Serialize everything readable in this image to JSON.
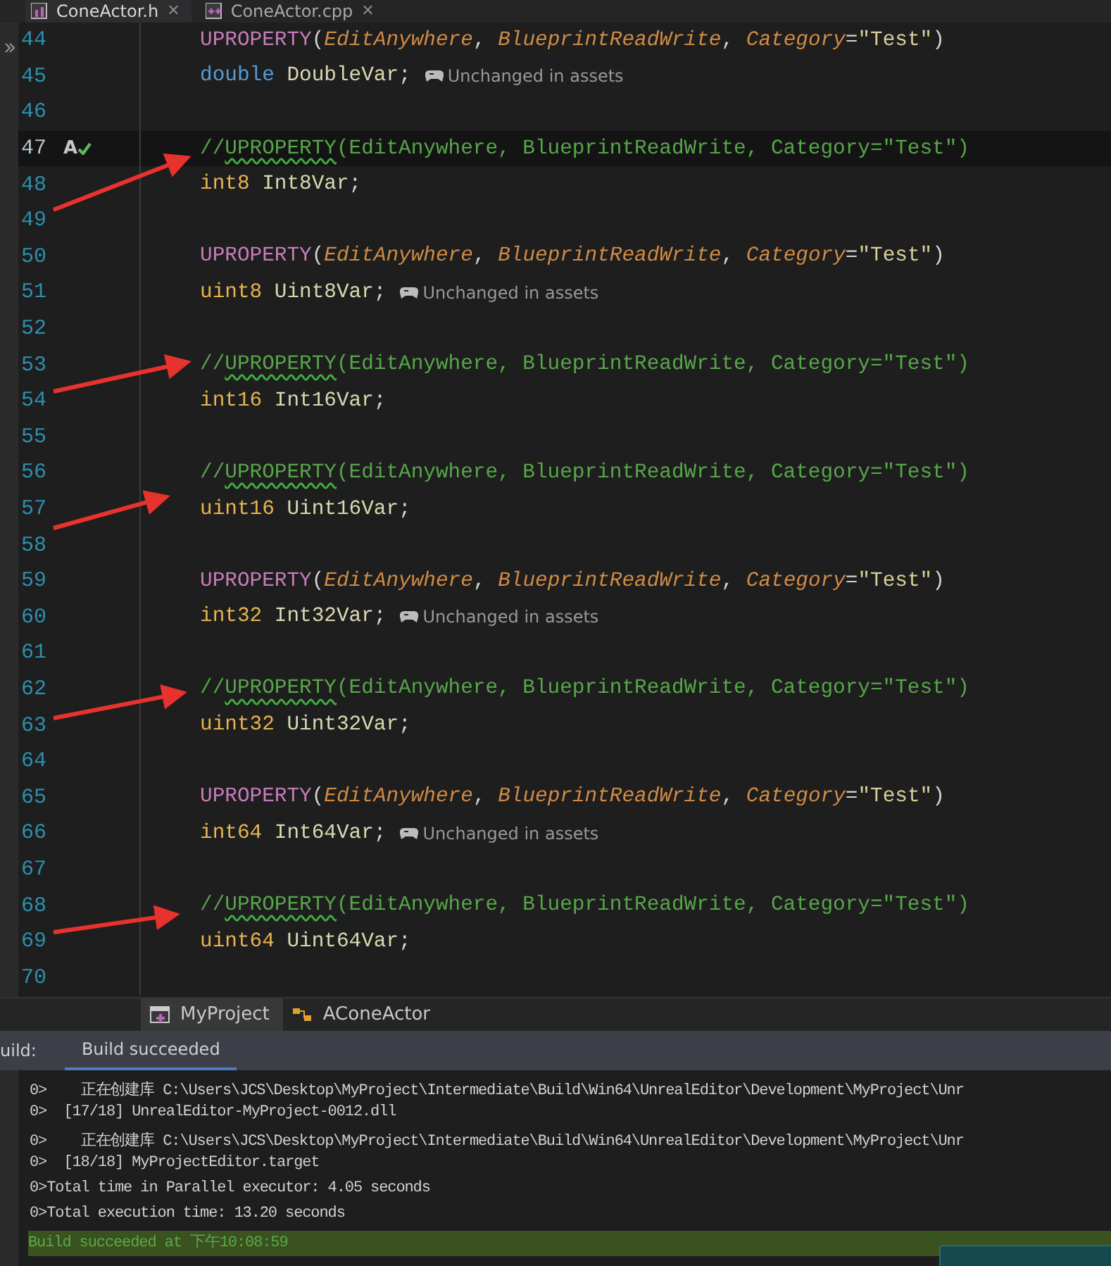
{
  "editor_tabs": [
    {
      "label": "ConeActor.h",
      "kind": "header",
      "close": "✕",
      "selected": true
    },
    {
      "label": "ConeActor.cpp",
      "kind": "source",
      "close": "✕",
      "selected": false
    }
  ],
  "code_lines": [
    {
      "number": "44",
      "tokens": [
        {
          "text": "UPROPERTY",
          "kind": "macro"
        },
        {
          "text": "(",
          "kind": "punct"
        },
        {
          "text": "EditAnywhere",
          "kind": "param"
        },
        {
          "text": ", ",
          "kind": "punct"
        },
        {
          "text": "BlueprintReadWrite",
          "kind": "param"
        },
        {
          "text": ", ",
          "kind": "punct"
        },
        {
          "text": "Category",
          "kind": "param"
        },
        {
          "text": "=",
          "kind": "punct"
        },
        {
          "text": "\"Test\"",
          "kind": "string"
        },
        {
          "text": ")",
          "kind": "punct"
        }
      ]
    },
    {
      "number": "45",
      "tokens": [
        {
          "text": "double",
          "kind": "keyword"
        },
        {
          "text": "DoubleVar",
          "kind": "ident"
        },
        {
          "text": ";",
          "kind": "punct"
        }
      ],
      "hint": "Unchanged in assets"
    },
    {
      "number": "46"
    },
    {
      "number": "47",
      "current": true,
      "gutter_mark": "A",
      "tokens": [
        {
          "text": "//",
          "kind": "comment"
        },
        {
          "text": "UPROPERTY",
          "kind": "squiggle"
        },
        {
          "text": "(EditAnywhere, BlueprintReadWrite, Category=\"Test\")",
          "kind": "comment"
        }
      ]
    },
    {
      "number": "48",
      "tokens": [
        {
          "text": "int8",
          "kind": "type"
        },
        {
          "text": "Int8Var",
          "kind": "ident"
        },
        {
          "text": ";",
          "kind": "punct"
        }
      ]
    },
    {
      "number": "49"
    },
    {
      "number": "50",
      "tokens": [
        {
          "text": "UPROPERTY",
          "kind": "macro"
        },
        {
          "text": "(",
          "kind": "punct"
        },
        {
          "text": "EditAnywhere",
          "kind": "param"
        },
        {
          "text": ", ",
          "kind": "punct"
        },
        {
          "text": "BlueprintReadWrite",
          "kind": "param"
        },
        {
          "text": ", ",
          "kind": "punct"
        },
        {
          "text": "Category",
          "kind": "param"
        },
        {
          "text": "=",
          "kind": "punct"
        },
        {
          "text": "\"Test\"",
          "kind": "string"
        },
        {
          "text": ")",
          "kind": "punct"
        }
      ]
    },
    {
      "number": "51",
      "tokens": [
        {
          "text": "uint8",
          "kind": "type"
        },
        {
          "text": "Uint8Var",
          "kind": "ident"
        },
        {
          "text": ";",
          "kind": "punct"
        }
      ],
      "hint": "Unchanged in assets"
    },
    {
      "number": "52"
    },
    {
      "number": "53",
      "tokens": [
        {
          "text": "//",
          "kind": "comment"
        },
        {
          "text": "UPROPERTY",
          "kind": "squiggle"
        },
        {
          "text": "(EditAnywhere, BlueprintReadWrite, Category=\"Test\")",
          "kind": "comment"
        }
      ]
    },
    {
      "number": "54",
      "tokens": [
        {
          "text": "int16",
          "kind": "type"
        },
        {
          "text": "Int16Var",
          "kind": "ident"
        },
        {
          "text": ";",
          "kind": "punct"
        }
      ]
    },
    {
      "number": "55"
    },
    {
      "number": "56",
      "tokens": [
        {
          "text": "//",
          "kind": "comment"
        },
        {
          "text": "UPROPERTY",
          "kind": "squiggle"
        },
        {
          "text": "(EditAnywhere, BlueprintReadWrite, Category=\"Test\")",
          "kind": "comment"
        }
      ]
    },
    {
      "number": "57",
      "tokens": [
        {
          "text": "uint16",
          "kind": "type"
        },
        {
          "text": "Uint16Var",
          "kind": "ident"
        },
        {
          "text": ";",
          "kind": "punct"
        }
      ]
    },
    {
      "number": "58"
    },
    {
      "number": "59",
      "tokens": [
        {
          "text": "UPROPERTY",
          "kind": "macro"
        },
        {
          "text": "(",
          "kind": "punct"
        },
        {
          "text": "EditAnywhere",
          "kind": "param"
        },
        {
          "text": ", ",
          "kind": "punct"
        },
        {
          "text": "BlueprintReadWrite",
          "kind": "param"
        },
        {
          "text": ", ",
          "kind": "punct"
        },
        {
          "text": "Category",
          "kind": "param"
        },
        {
          "text": "=",
          "kind": "punct"
        },
        {
          "text": "\"Test\"",
          "kind": "string"
        },
        {
          "text": ")",
          "kind": "punct"
        }
      ]
    },
    {
      "number": "60",
      "tokens": [
        {
          "text": "int32",
          "kind": "type"
        },
        {
          "text": "Int32Var",
          "kind": "ident"
        },
        {
          "text": ";",
          "kind": "punct"
        }
      ],
      "hint": "Unchanged in assets"
    },
    {
      "number": "61"
    },
    {
      "number": "62",
      "tokens": [
        {
          "text": "//",
          "kind": "comment"
        },
        {
          "text": "UPROPERTY",
          "kind": "squiggle"
        },
        {
          "text": "(EditAnywhere, BlueprintReadWrite, Category=\"Test\")",
          "kind": "comment"
        }
      ]
    },
    {
      "number": "63",
      "tokens": [
        {
          "text": "uint32",
          "kind": "type"
        },
        {
          "text": "Uint32Var",
          "kind": "ident"
        },
        {
          "text": ";",
          "kind": "punct"
        }
      ]
    },
    {
      "number": "64"
    },
    {
      "number": "65",
      "tokens": [
        {
          "text": "UPROPERTY",
          "kind": "macro"
        },
        {
          "text": "(",
          "kind": "punct"
        },
        {
          "text": "EditAnywhere",
          "kind": "param"
        },
        {
          "text": ", ",
          "kind": "punct"
        },
        {
          "text": "BlueprintReadWrite",
          "kind": "param"
        },
        {
          "text": ", ",
          "kind": "punct"
        },
        {
          "text": "Category",
          "kind": "param"
        },
        {
          "text": "=",
          "kind": "punct"
        },
        {
          "text": "\"Test\"",
          "kind": "string"
        },
        {
          "text": ")",
          "kind": "punct"
        }
      ]
    },
    {
      "number": "66",
      "tokens": [
        {
          "text": "int64",
          "kind": "type"
        },
        {
          "text": "Int64Var",
          "kind": "ident"
        },
        {
          "text": ";",
          "kind": "punct"
        }
      ],
      "hint": "Unchanged in assets"
    },
    {
      "number": "67"
    },
    {
      "number": "68",
      "tokens": [
        {
          "text": "//",
          "kind": "comment"
        },
        {
          "text": "UPROPERTY",
          "kind": "squiggle"
        },
        {
          "text": "(EditAnywhere, BlueprintReadWrite, Category=\"Test\")",
          "kind": "comment"
        }
      ]
    },
    {
      "number": "69",
      "tokens": [
        {
          "text": "uint64",
          "kind": "type"
        },
        {
          "text": "Uint64Var",
          "kind": "ident"
        },
        {
          "text": ";",
          "kind": "punct"
        }
      ]
    },
    {
      "number": "70"
    }
  ],
  "bottom_tabs": [
    {
      "label": "MyProject",
      "kind": "project",
      "selected": true
    },
    {
      "label": "AConeActor",
      "kind": "class",
      "selected": false
    }
  ],
  "build_panel": {
    "title": "uild:",
    "tabs": [
      {
        "label": "Build succeeded",
        "selected": true
      }
    ],
    "output": [
      {
        "text": "0>    正在创建库 C:\\Users\\JCS\\Desktop\\MyProject\\Intermediate\\Build\\Win64\\UnrealEditor\\Development\\MyProject\\Unr",
        "kind": "normal"
      },
      {
        "text": "0>  [17/18] UnrealEditor-MyProject-0012.dll",
        "kind": "normal"
      },
      {
        "text": "0>    正在创建库 C:\\Users\\JCS\\Desktop\\MyProject\\Intermediate\\Build\\Win64\\UnrealEditor\\Development\\MyProject\\Unr",
        "kind": "normal"
      },
      {
        "text": "0>  [18/18] MyProjectEditor.target",
        "kind": "normal"
      },
      {
        "text": "0>Total time in Parallel executor: 4.05 seconds",
        "kind": "normal"
      },
      {
        "text": "0>Total execution time: 13.20 seconds",
        "kind": "normal"
      },
      {
        "text": "Build succeeded at 下午10:08:59",
        "kind": "success"
      }
    ]
  }
}
